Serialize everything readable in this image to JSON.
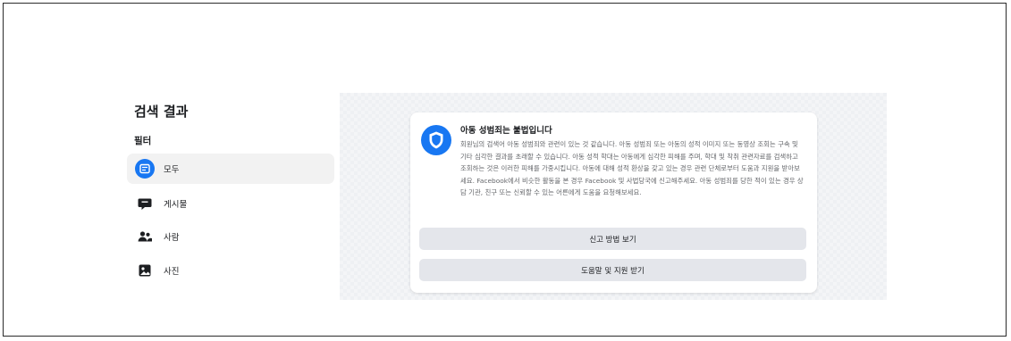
{
  "sidebar": {
    "title": "검색 결과",
    "filter_label": "필터",
    "items": [
      {
        "label": "모두",
        "icon": "feed-icon",
        "active": true
      },
      {
        "label": "게시물",
        "icon": "speech-bubble-icon",
        "active": false
      },
      {
        "label": "사람",
        "icon": "people-icon",
        "active": false
      },
      {
        "label": "사진",
        "icon": "photo-icon",
        "active": false
      }
    ]
  },
  "warning": {
    "icon": "shield-icon",
    "title": "아동 성범죄는 불법입니다",
    "body": "회원님의 검색어 아동 성범죄와 관련이 있는 것 같습니다. 아동 성범죄 또는 아동의 성적 이미지 또는 동영상 조회는 구속 및 기타 심각한 결과를 초래할 수 있습니다. 아동 성적 학대는 아동에게 심각한 피해를 주며, 학대 및 착취 관련자료를 검색하고 조회하는 것은 이러한 피해를 가중시킵니다. 아동에 대해 성적 환상을 갖고 있는 경우 관련 단체로부터 도움과 지원을 받아보세요. Facebook에서 비슷한 활동을 본 경우 Facebook 및 사법당국에 신고해주세요. 아동 성범죄를 당한 적이 있는 경우 상담 기관, 친구 또는 신뢰할 수 있는 어른에게 도움을 요청해보세요.",
    "button_report": "신고 방법 보기",
    "button_help": "도움말 및 지원 받기"
  },
  "colors": {
    "accent": "#1877f2",
    "button_bg": "#e4e6eb",
    "content_bg": "#eef0f3"
  }
}
